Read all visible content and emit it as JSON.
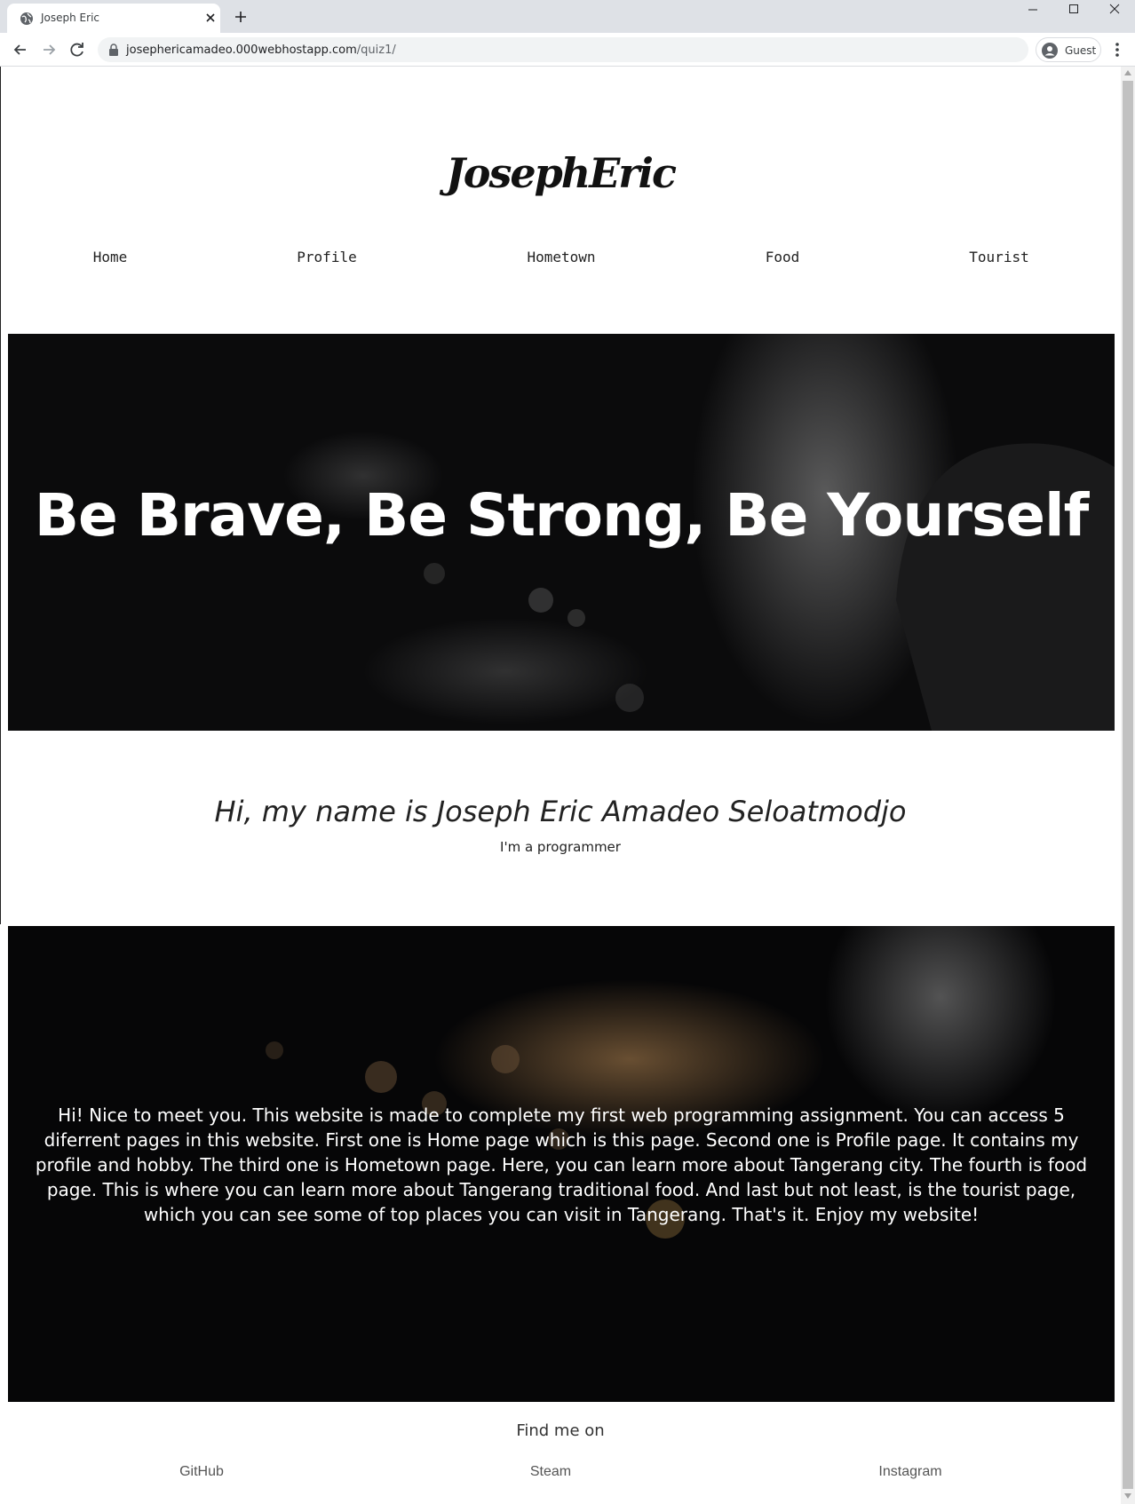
{
  "browser": {
    "tab_title": "Joseph Eric",
    "url_host": "josephericamadeo.000webhostapp.com",
    "url_path": "/quiz1/",
    "profile_label": "Guest"
  },
  "site": {
    "logo_text": "JosephEric",
    "nav": [
      "Home",
      "Profile",
      "Hometown",
      "Food",
      "Tourist"
    ],
    "hero_title": "Be Brave, Be Strong, Be Yourself",
    "intro_name": "Hi, my name is Joseph Eric Amadeo Seloatmodjo",
    "intro_sub": "I'm a programmer",
    "about_text": "Hi! Nice to meet you. This website is made to complete my first web programming assignment. You can access 5 diferrent pages in this website. First one is Home page which is this page. Second one is Profile page. It contains my profile and hobby. The third one is Hometown page. Here, you can learn more about Tangerang city. The fourth is food page. This is where you can learn more about Tangerang traditional food. And last but not least, is the tourist page, which you can see some of top places you can visit in Tangerang. That's it. Enjoy my website!",
    "find_me": "Find me on",
    "social": [
      "GitHub",
      "Steam",
      "Instagram"
    ]
  },
  "colors": {
    "chrome_tabbar": "#dee1e6",
    "hero_background": "#0b0b0c",
    "text_dark": "#222222",
    "text_light": "#ffffff"
  }
}
